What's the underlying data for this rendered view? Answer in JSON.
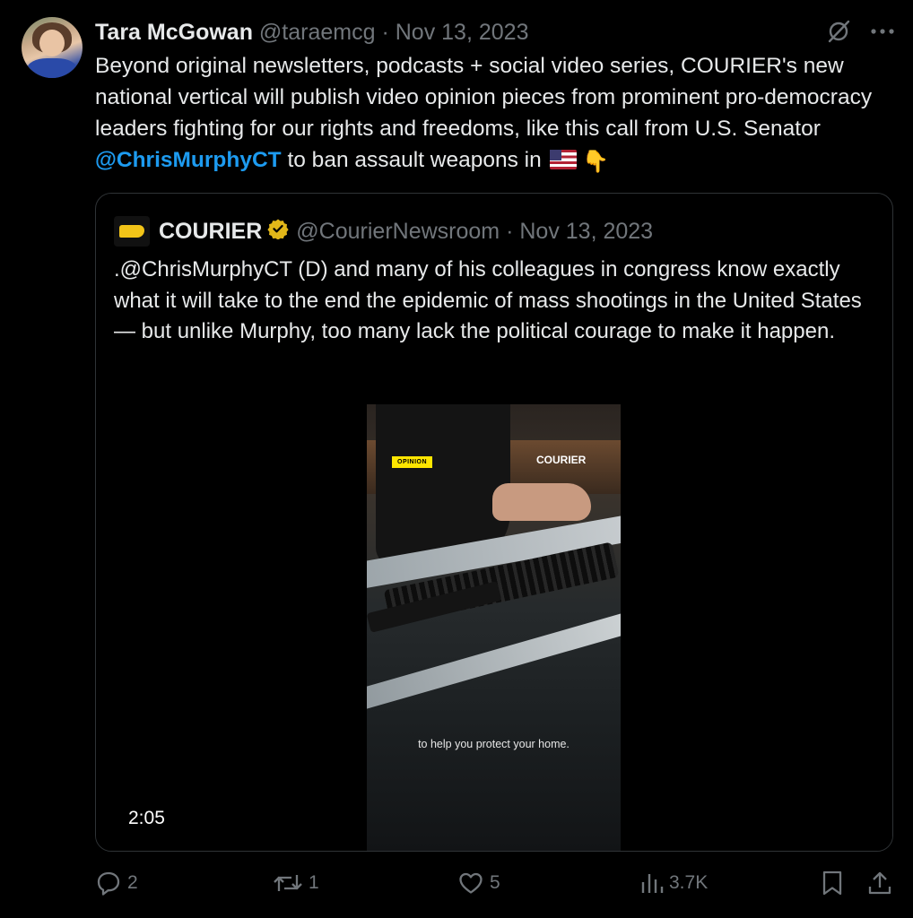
{
  "tweet": {
    "author_name": "Tara McGowan",
    "author_handle": "@taraemcg",
    "separator": "·",
    "date": "Nov 13, 2023",
    "text_part1": "Beyond original newsletters, podcasts + social video series, COURIER's new national vertical will publish video opinion pieces from prominent pro-democracy leaders fighting for our rights and freedoms, like this call from U.S. Senator ",
    "mention": "@ChrisMurphyCT",
    "text_part2": " to ban assault weapons in ",
    "emoji_pointer": "👇"
  },
  "quote": {
    "author_name": "COURIER",
    "author_handle": "@CourierNewsroom",
    "separator": "·",
    "date": "Nov 13, 2023",
    "text": ".@ChrisMurphyCT (D) and many of his colleagues in congress know exactly what it will take to the end the epidemic of mass shootings in the United States — but unlike Murphy, too many lack the political courage to make it happen.",
    "video": {
      "opinion_label": "OPINION",
      "brand_label": "COURIER",
      "caption": "to help you protect your home.",
      "duration": "2:05"
    }
  },
  "actions": {
    "replies": "2",
    "reposts": "1",
    "likes": "5",
    "views": "3.7K"
  },
  "icons": [
    "grok-icon",
    "more-icon",
    "verified-badge-icon",
    "reply-icon",
    "repost-icon",
    "like-icon",
    "views-icon",
    "bookmark-icon",
    "share-icon"
  ],
  "colors": {
    "background": "#000000",
    "text": "#e7e9ea",
    "secondary": "#71767b",
    "link": "#1d9bf0",
    "verified_gold": "#e2b719"
  }
}
